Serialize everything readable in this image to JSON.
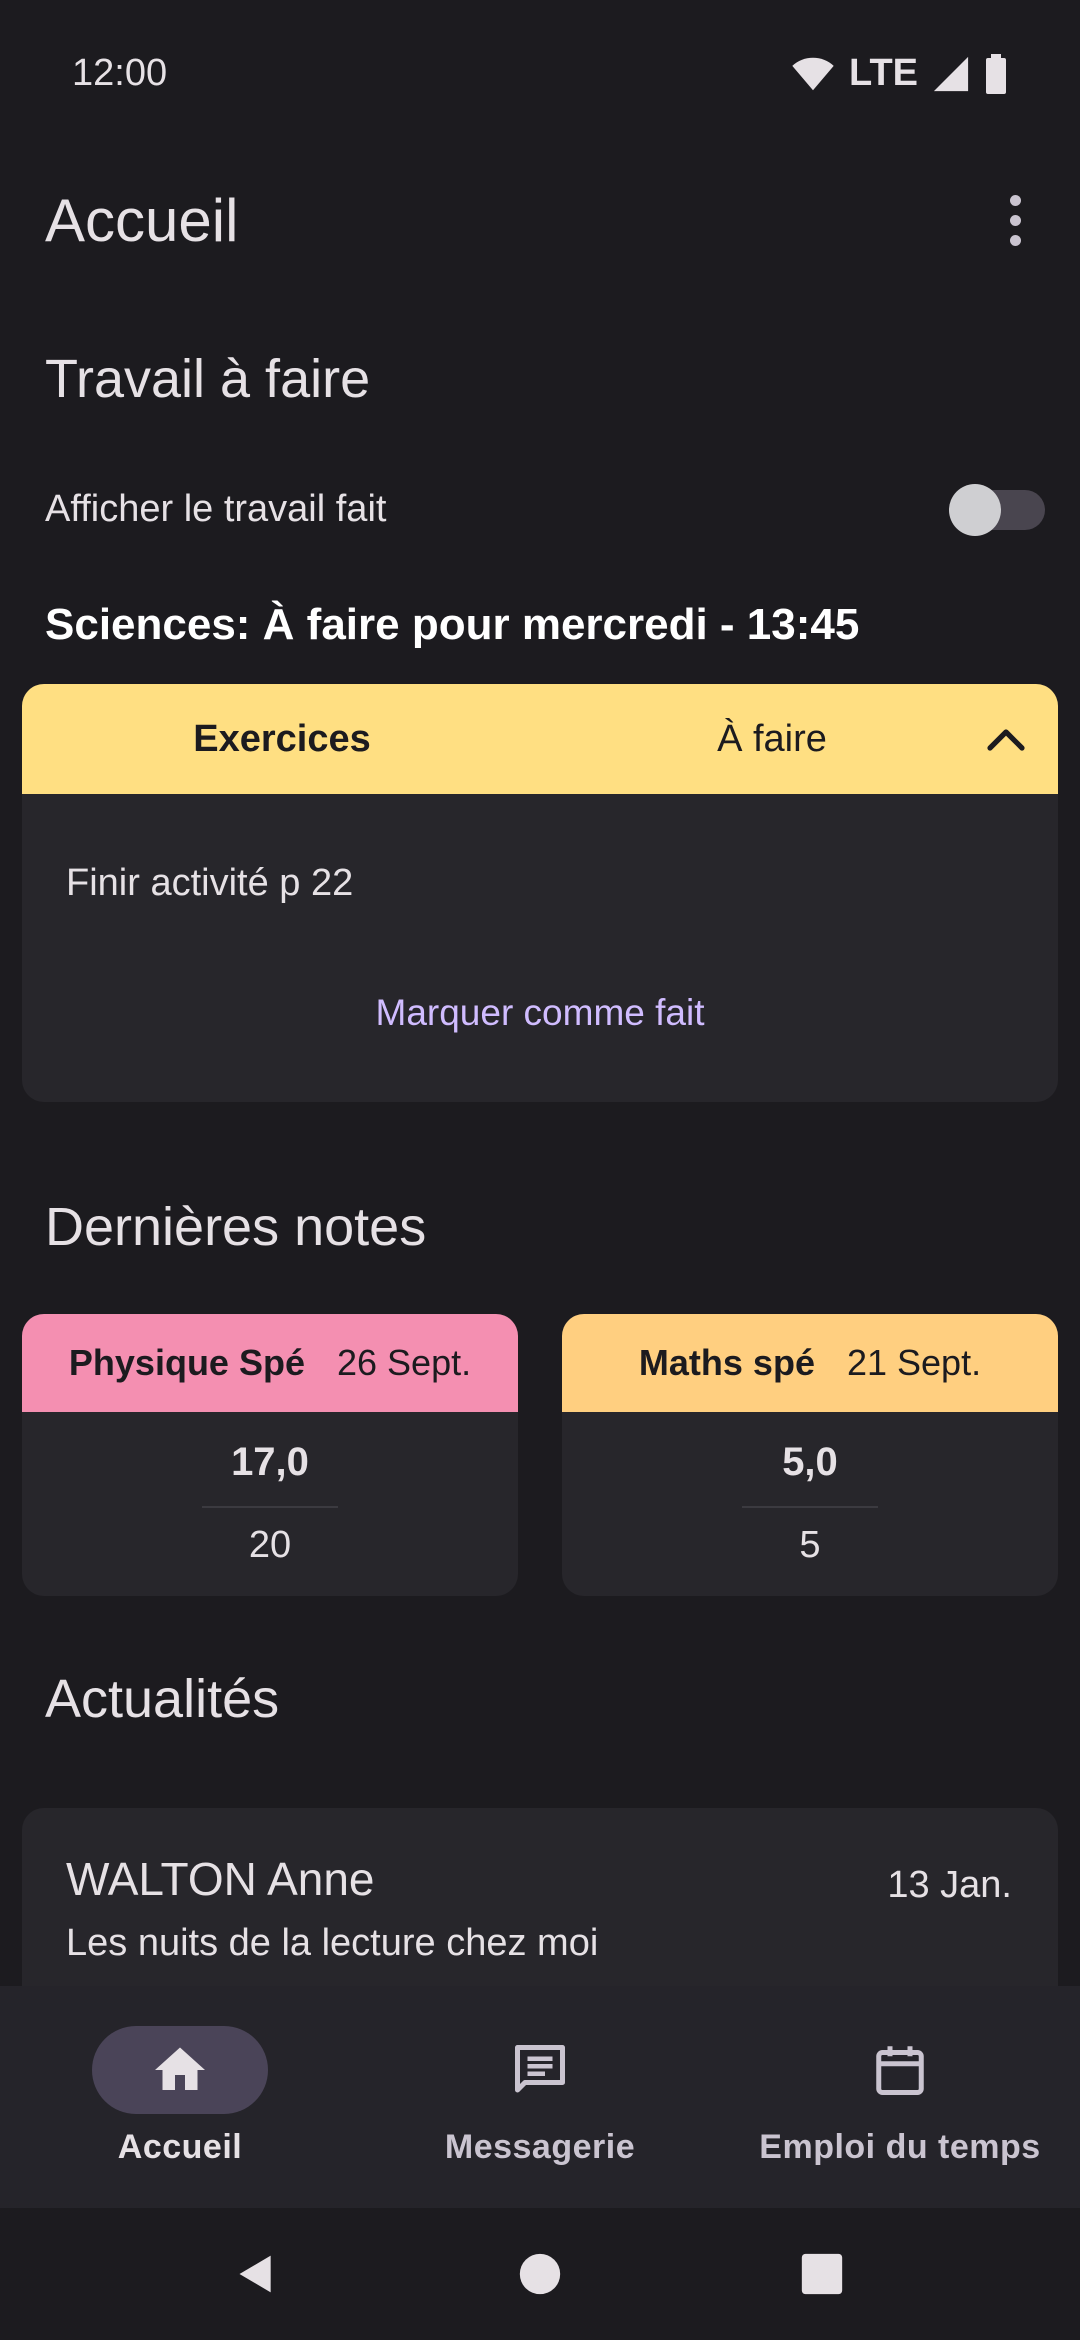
{
  "status_bar": {
    "time": "12:00",
    "network": "LTE"
  },
  "app_bar": {
    "title": "Accueil"
  },
  "homework": {
    "section_title": "Travail à faire",
    "toggle_label": "Afficher le travail fait",
    "toggle_on": false,
    "heading": "Sciences: À faire pour mercredi - 13:45",
    "card": {
      "type": "Exercices",
      "status": "À faire",
      "description": "Finir activité p 22",
      "action_label": "Marquer comme fait",
      "header_color": "#ffdf82"
    }
  },
  "grades": {
    "section_title": "Dernières notes",
    "items": [
      {
        "subject": "Physique Spé",
        "date": "26 Sept.",
        "value": "17,0",
        "out_of": "20",
        "color": "#f48fb1"
      },
      {
        "subject": "Maths spé",
        "date": "21 Sept.",
        "value": "5,0",
        "out_of": "5",
        "color": "#ffcf80"
      }
    ]
  },
  "news": {
    "section_title": "Actualités",
    "items": [
      {
        "author": "WALTON Anne",
        "date": "13 Jan.",
        "title": "Les nuits de la lecture chez moi"
      }
    ]
  },
  "bottom_nav": {
    "items": [
      {
        "label": "Accueil",
        "icon": "home-icon",
        "active": true
      },
      {
        "label": "Messagerie",
        "icon": "message-icon",
        "active": false
      },
      {
        "label": "Emploi du temps",
        "icon": "calendar-icon",
        "active": false
      }
    ]
  },
  "system_nav": {
    "icons": [
      "back-icon",
      "home-circle-icon",
      "recents-icon"
    ]
  }
}
